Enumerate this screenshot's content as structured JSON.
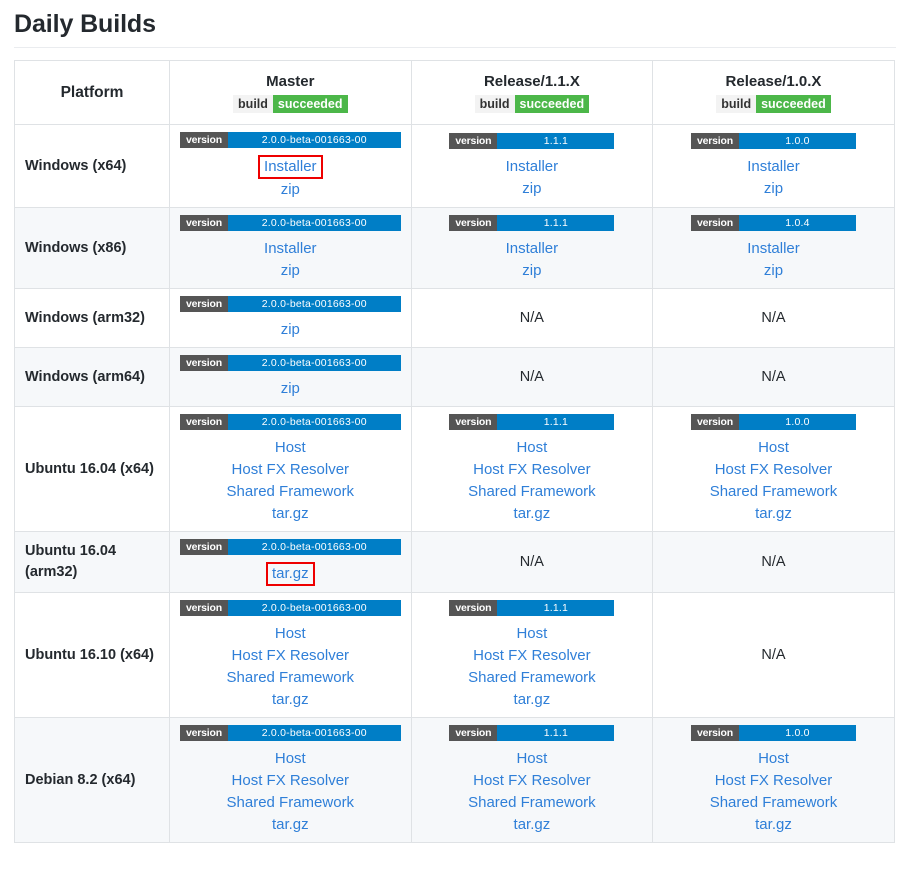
{
  "page": {
    "title": "Daily Builds"
  },
  "table": {
    "columns": [
      {
        "id": "platform",
        "label": "Platform"
      },
      {
        "id": "master",
        "branch": "Master",
        "build_label": "build",
        "build_status": "succeeded"
      },
      {
        "id": "rel11",
        "branch": "Release/1.1.X",
        "build_label": "build",
        "build_status": "succeeded"
      },
      {
        "id": "rel10",
        "branch": "Release/1.0.X",
        "build_label": "build",
        "build_status": "succeeded"
      }
    ],
    "version_label": "version",
    "na": "N/A",
    "rows": [
      {
        "platform": "Windows (x64)",
        "master": {
          "version": "2.0.0-beta-001663-00",
          "links": [
            "Installer",
            "zip"
          ],
          "highlight": "Installer"
        },
        "rel11": {
          "version": "1.1.1",
          "links": [
            "Installer",
            "zip"
          ]
        },
        "rel10": {
          "version": "1.0.0",
          "links": [
            "Installer",
            "zip"
          ]
        }
      },
      {
        "platform": "Windows (x86)",
        "master": {
          "version": "2.0.0-beta-001663-00",
          "links": [
            "Installer",
            "zip"
          ]
        },
        "rel11": {
          "version": "1.1.1",
          "links": [
            "Installer",
            "zip"
          ]
        },
        "rel10": {
          "version": "1.0.4",
          "links": [
            "Installer",
            "zip"
          ]
        }
      },
      {
        "platform": "Windows (arm32)",
        "master": {
          "version": "2.0.0-beta-001663-00",
          "links": [
            "zip"
          ]
        },
        "rel11": {
          "na": true
        },
        "rel10": {
          "na": true
        }
      },
      {
        "platform": "Windows (arm64)",
        "master": {
          "version": "2.0.0-beta-001663-00",
          "links": [
            "zip"
          ]
        },
        "rel11": {
          "na": true
        },
        "rel10": {
          "na": true
        }
      },
      {
        "platform": "Ubuntu 16.04 (x64)",
        "master": {
          "version": "2.0.0-beta-001663-00",
          "links": [
            "Host",
            "Host FX Resolver",
            "Shared Framework",
            "tar.gz"
          ]
        },
        "rel11": {
          "version": "1.1.1",
          "links": [
            "Host",
            "Host FX Resolver",
            "Shared Framework",
            "tar.gz"
          ]
        },
        "rel10": {
          "version": "1.0.0",
          "links": [
            "Host",
            "Host FX Resolver",
            "Shared Framework",
            "tar.gz"
          ]
        }
      },
      {
        "platform": "Ubuntu 16.04 (arm32)",
        "master": {
          "version": "2.0.0-beta-001663-00",
          "links": [
            "tar.gz"
          ],
          "highlight": "tar.gz"
        },
        "rel11": {
          "na": true
        },
        "rel10": {
          "na": true
        }
      },
      {
        "platform": "Ubuntu 16.10 (x64)",
        "master": {
          "version": "2.0.0-beta-001663-00",
          "links": [
            "Host",
            "Host FX Resolver",
            "Shared Framework",
            "tar.gz"
          ]
        },
        "rel11": {
          "version": "1.1.1",
          "links": [
            "Host",
            "Host FX Resolver",
            "Shared Framework",
            "tar.gz"
          ]
        },
        "rel10": {
          "na": true
        }
      },
      {
        "platform": "Debian 8.2 (x64)",
        "master": {
          "version": "2.0.0-beta-001663-00",
          "links": [
            "Host",
            "Host FX Resolver",
            "Shared Framework",
            "tar.gz"
          ]
        },
        "rel11": {
          "version": "1.1.1",
          "links": [
            "Host",
            "Host FX Resolver",
            "Shared Framework",
            "tar.gz"
          ]
        },
        "rel10": {
          "version": "1.0.0",
          "links": [
            "Host",
            "Host FX Resolver",
            "Shared Framework",
            "tar.gz"
          ]
        }
      }
    ]
  },
  "colors": {
    "link": "#2f7fd8",
    "shield_label_bg": "#555555",
    "shield_value_bg": "#007ec6",
    "build_success_bg": "#4cb749",
    "build_label_bg": "#f3f3f3",
    "highlight_border": "#ee0000",
    "table_border": "#dfe2e5",
    "alt_row_bg": "#f6f8fa"
  }
}
